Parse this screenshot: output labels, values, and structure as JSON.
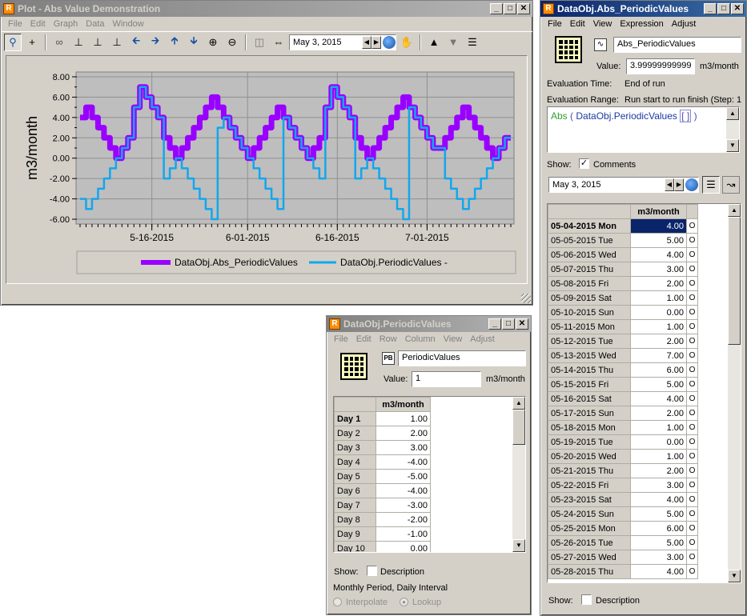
{
  "plot_window": {
    "title": "Plot - Abs Value Demonstration",
    "menu": [
      "File",
      "Edit",
      "Graph",
      "Data",
      "Window"
    ],
    "date": "May 3, 2015",
    "window_buttons": [
      "_",
      "□",
      "✕"
    ]
  },
  "chart_data": {
    "type": "line",
    "ylabel": "m3/month",
    "ylim": [
      -6,
      8
    ],
    "yticks": [
      "8.00",
      "6.00",
      "4.00",
      "2.00",
      "0.00",
      "-2.00",
      "-4.00",
      "-6.00"
    ],
    "xtick_labels": [
      "5-16-2015",
      "6-01-2015",
      "6-16-2015",
      "7-01-2015"
    ],
    "xtick_days": [
      12,
      28,
      43,
      58
    ],
    "grid": true,
    "legend_position": "bottom",
    "series": [
      {
        "name": "DataObj.Abs_PeriodicValues",
        "color": "#9900ff",
        "values": [
          4,
          5,
          4,
          3,
          2,
          1,
          0,
          1,
          2,
          5,
          7,
          6,
          5,
          4,
          2,
          1,
          0,
          1,
          2,
          3,
          4,
          5,
          6,
          5,
          4,
          3,
          2,
          1,
          0,
          1,
          2,
          3,
          4,
          5,
          4,
          3,
          2,
          1,
          0,
          1,
          2,
          5,
          7,
          6,
          5,
          4,
          2,
          1,
          0,
          1,
          2,
          3,
          4,
          5,
          6,
          5,
          4,
          3,
          2,
          1,
          1,
          2,
          3,
          4,
          5,
          4,
          3,
          2,
          1,
          0,
          1,
          2
        ]
      },
      {
        "name": "DataObj.PeriodicValues -",
        "color": "#11a7ee",
        "values": [
          -4,
          -5,
          -4,
          -3,
          -2,
          -1,
          0,
          1,
          2,
          5,
          7,
          6,
          5,
          4,
          -2,
          -1,
          0,
          -1,
          -2,
          -3,
          -4,
          -5,
          -6,
          3,
          4,
          3,
          2,
          1,
          0,
          -1,
          -2,
          -3,
          -4,
          -5,
          4,
          3,
          2,
          1,
          0,
          -1,
          -2,
          5,
          7,
          6,
          5,
          4,
          -2,
          -1,
          0,
          -1,
          -2,
          -3,
          -4,
          -5,
          -6,
          5,
          4,
          3,
          2,
          1,
          1,
          -2,
          -3,
          -4,
          -5,
          -4,
          -3,
          -2,
          -1,
          0,
          1,
          2
        ]
      }
    ]
  },
  "abs_window": {
    "title": "DataObj.Abs_PeriodicValues",
    "menu": [
      "File",
      "Edit",
      "View",
      "Expression",
      "Adjust"
    ],
    "name": "Abs_PeriodicValues",
    "value_label": "Value:",
    "value": "3.99999999999",
    "unit": "m3/month",
    "eval_time_label": "Evaluation Time:",
    "eval_time": "End of run",
    "eval_range_label": "Evaluation Range:",
    "eval_range": "Run start to run finish (Step: 1",
    "expression_fn": "Abs",
    "expression_open": "(",
    "expression_arg": "DataObj.PeriodicValues",
    "expression_brackets": "[ ]",
    "expression_close": ")",
    "show_label": "Show:",
    "comments_label": "Comments",
    "comments_checked": "✓",
    "date": "May 3, 2015",
    "column_header": "m3/month",
    "rows": [
      {
        "date": "05-04-2015 Mon",
        "value": "4.00"
      },
      {
        "date": "05-05-2015 Tue",
        "value": "5.00"
      },
      {
        "date": "05-06-2015 Wed",
        "value": "4.00"
      },
      {
        "date": "05-07-2015 Thu",
        "value": "3.00"
      },
      {
        "date": "05-08-2015 Fri",
        "value": "2.00"
      },
      {
        "date": "05-09-2015 Sat",
        "value": "1.00"
      },
      {
        "date": "05-10-2015 Sun",
        "value": "0.00"
      },
      {
        "date": "05-11-2015 Mon",
        "value": "1.00"
      },
      {
        "date": "05-12-2015 Tue",
        "value": "2.00"
      },
      {
        "date": "05-13-2015 Wed",
        "value": "7.00"
      },
      {
        "date": "05-14-2015 Thu",
        "value": "6.00"
      },
      {
        "date": "05-15-2015 Fri",
        "value": "5.00"
      },
      {
        "date": "05-16-2015 Sat",
        "value": "4.00"
      },
      {
        "date": "05-17-2015 Sun",
        "value": "2.00"
      },
      {
        "date": "05-18-2015 Mon",
        "value": "1.00"
      },
      {
        "date": "05-19-2015 Tue",
        "value": "0.00"
      },
      {
        "date": "05-20-2015 Wed",
        "value": "1.00"
      },
      {
        "date": "05-21-2015 Thu",
        "value": "2.00"
      },
      {
        "date": "05-22-2015 Fri",
        "value": "3.00"
      },
      {
        "date": "05-23-2015 Sat",
        "value": "4.00"
      },
      {
        "date": "05-24-2015 Sun",
        "value": "5.00"
      },
      {
        "date": "05-25-2015 Mon",
        "value": "6.00"
      },
      {
        "date": "05-26-2015 Tue",
        "value": "5.00"
      },
      {
        "date": "05-27-2015 Wed",
        "value": "3.00"
      },
      {
        "date": "05-28-2015 Thu",
        "value": "4.00"
      }
    ],
    "row_flag": "O",
    "bottom_show_label": "Show:",
    "description_label": "Description"
  },
  "periodic_window": {
    "title": "DataObj.PeriodicValues",
    "menu": [
      "File",
      "Edit",
      "Row",
      "Column",
      "View",
      "Adjust"
    ],
    "name": "PeriodicValues",
    "type_badge": "PB",
    "value_label": "Value:",
    "value": "1",
    "unit": "m3/month",
    "column_header": "m3/month",
    "rows": [
      {
        "label": "Day 1",
        "value": "1.00"
      },
      {
        "label": "Day 2",
        "value": "2.00"
      },
      {
        "label": "Day 3",
        "value": "3.00"
      },
      {
        "label": "Day 4",
        "value": "-4.00"
      },
      {
        "label": "Day 5",
        "value": "-5.00"
      },
      {
        "label": "Day 6",
        "value": "-4.00"
      },
      {
        "label": "Day 7",
        "value": "-3.00"
      },
      {
        "label": "Day 8",
        "value": "-2.00"
      },
      {
        "label": "Day 9",
        "value": "-1.00"
      },
      {
        "label": "Day 10",
        "value": "0.00"
      }
    ],
    "show_label": "Show:",
    "description_label": "Description",
    "period_text": "Monthly Period, Daily Interval",
    "interpolate_label": "Interpolate",
    "lookup_label": "Lookup"
  }
}
